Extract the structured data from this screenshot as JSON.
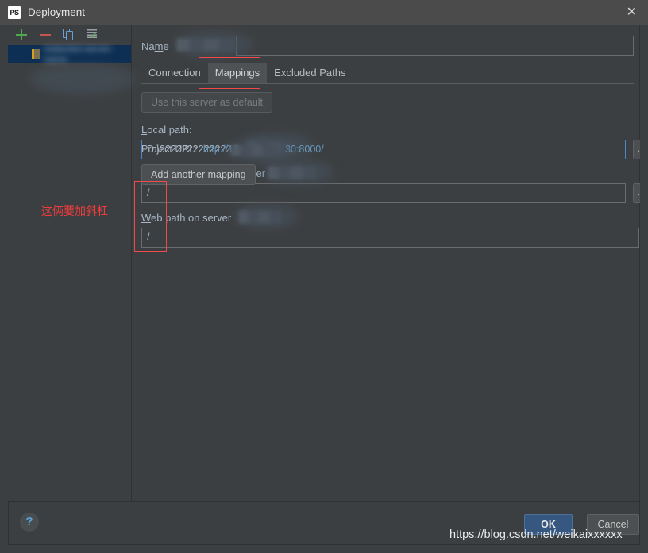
{
  "window": {
    "title": "Deployment",
    "app_icon": "phpstorm-icon",
    "close_label": "✕"
  },
  "sidebar": {
    "toolbar": [
      {
        "name": "add-server-button",
        "icon": "plus-icon",
        "label": "+"
      },
      {
        "name": "remove-server-button",
        "icon": "minus-icon",
        "label": "−"
      },
      {
        "name": "copy-server-button",
        "icon": "copy-icon",
        "label": ""
      },
      {
        "name": "use-as-default-button",
        "icon": "set-default-icon",
        "label": "✓"
      }
    ],
    "servers": [
      {
        "label": "redacted-server-name",
        "selected": true
      }
    ]
  },
  "form": {
    "name_label": "Name",
    "name_mnemonic": "m",
    "name_value": "",
    "tabs": [
      {
        "label": "Connection",
        "selected": false
      },
      {
        "label": "Mappings",
        "selected": true
      },
      {
        "label": "Excluded Paths",
        "selected": false
      }
    ],
    "use_default_button": "Use this server as default",
    "use_default_disabled": true,
    "local_path_label": "Local path:",
    "local_path_mnemonic": "L",
    "local_path_value": "D:\\2222222222222",
    "local_path_browse": "...",
    "deployment_path_label": "Deployment path on server",
    "deployment_path_mnemonic": "e",
    "deployment_path_value": "/",
    "deployment_path_browse": "...",
    "web_path_label": "Web path on server",
    "web_path_mnemonic": "W",
    "web_path_value": "/",
    "project_url_label": "Project URL:",
    "project_url_value_start": "http://19",
    "project_url_value_end": "30:8000/",
    "add_mapping_button": "Add another mapping",
    "add_mapping_mnemonic": "d"
  },
  "annotations": {
    "note_text": "这俩要加斜杠",
    "note_color": "#f23c3c"
  },
  "footer": {
    "help_label": "?",
    "ok_label": "OK",
    "cancel_label": "Cancel"
  },
  "watermark": {
    "text": "https://blog.csdn.net/weikaixxxxxx"
  },
  "colors": {
    "background": "#3c3f41",
    "titlebar": "#4b4b4b",
    "accent_blue": "#365880",
    "link_blue": "#6897bb",
    "selection_blue": "#0d2f53",
    "annotation_red": "#f23c3c",
    "focus_border": "#4a88c7"
  }
}
